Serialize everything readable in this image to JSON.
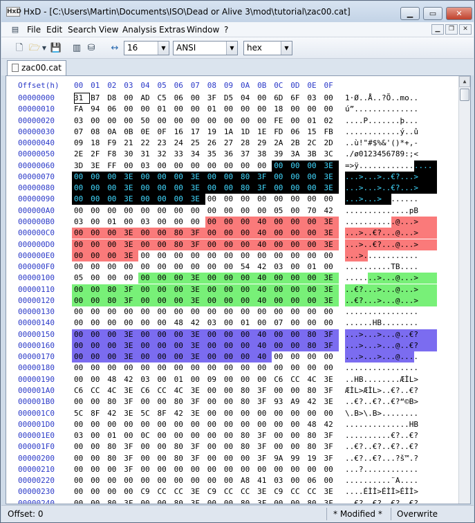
{
  "window": {
    "title": "HxD - [C:\\Users\\Martin\\Documents\\ISO\\Dead or Alive 3\\mod\\tutorial\\zac00.cat]",
    "app_icon": "HxD"
  },
  "menu": [
    "File",
    "Edit",
    "Search",
    "View",
    "Analysis",
    "Extras",
    "Window",
    "?"
  ],
  "toolbar": {
    "bytes_per_row": "16",
    "charset": "ANSI",
    "offset_base": "hex"
  },
  "tab": {
    "label": "zac00.cat"
  },
  "header": {
    "offset_label": "Offset(h)",
    "columns": [
      "00",
      "01",
      "02",
      "03",
      "04",
      "05",
      "06",
      "07",
      "08",
      "09",
      "0A",
      "0B",
      "0C",
      "0D",
      "0E",
      "0F"
    ]
  },
  "colors": {
    "black": "#000000",
    "red": "#fa7a7a",
    "green": "#78f078",
    "blue": "#7b6cf0",
    "offset": "#2a39c8"
  },
  "rows": [
    {
      "offset": "00000000",
      "bytes": "31 B7 D8 00 AD C5 06 00 3F D5 04 00 6D 6F 03 00",
      "ascii": "1·Ø..Å..?Õ..mo.."
    },
    {
      "offset": "00000010",
      "bytes": "FA 94 06 00 00 01 00 00 01 00 00 00 18 00 00 00",
      "ascii": "ú”.............."
    },
    {
      "offset": "00000020",
      "bytes": "03 00 00 00 50 00 00 00 00 00 00 00 FE 00 01 02",
      "ascii": "....P.......þ..."
    },
    {
      "offset": "00000030",
      "bytes": "07 08 0A 0B 0E 0F 16 17 19 1A 1D 1E FD 06 15 FB",
      "ascii": "............ý..û"
    },
    {
      "offset": "00000040",
      "bytes": "09 18 F9 21 22 23 24 25 26 27 28 29 2A 2B 2C 2D",
      "ascii": "..ù!\"#$%&'()*+,-"
    },
    {
      "offset": "00000050",
      "bytes": "2E 2F F8 30 31 32 33 34 35 36 37 38 39 3A 3B 3C",
      "ascii": "./ø0123456789:;<"
    },
    {
      "offset": "00000060",
      "bytes": "3D 3E FF 00 03 00 00 00 00 00 00 00 00 00 00 3E",
      "ascii": "=>ÿ.............>"
    },
    {
      "offset": "00000070",
      "bytes": "00 00 00 3E 00 00 00 3E 00 00 80 3F 00 00 00 3E",
      "ascii": "...>...>..€?...>"
    },
    {
      "offset": "00000080",
      "bytes": "00 00 00 3E 00 00 00 3E 00 00 80 3F 00 00 00 3E",
      "ascii": "...>...>..€?...>"
    },
    {
      "offset": "00000090",
      "bytes": "00 00 00 3E 00 00 00 3E 00 00 00 00 00 00 00 00",
      "ascii": "...>...>........"
    },
    {
      "offset": "000000A0",
      "bytes": "00 00 00 00 00 00 00 00 00 00 00 00 05 00 70 42",
      "ascii": "..............pB"
    },
    {
      "offset": "000000B0",
      "bytes": "03 00 01 00 03 00 00 00 00 00 00 40 00 00 00 3E",
      "ascii": "...........@...>"
    },
    {
      "offset": "000000C0",
      "bytes": "00 00 00 3E 00 00 80 3F 00 00 00 40 00 00 00 3E",
      "ascii": "...>..€?...@...>"
    },
    {
      "offset": "000000D0",
      "bytes": "00 00 00 3E 00 00 80 3F 00 00 00 40 00 00 00 3E",
      "ascii": "...>..€?...@...>"
    },
    {
      "offset": "000000E0",
      "bytes": "00 00 00 3E 00 00 00 00 00 00 00 00 00 00 00 00",
      "ascii": "...>............"
    },
    {
      "offset": "000000F0",
      "bytes": "00 00 00 00 00 00 00 00 00 00 54 42 03 00 01 00",
      "ascii": "..........TB...."
    },
    {
      "offset": "00000100",
      "bytes": "05 00 00 00 00 00 00 3E 00 00 00 40 00 00 00 3E",
      "ascii": ".......>...@...>"
    },
    {
      "offset": "00000110",
      "bytes": "00 00 80 3F 00 00 00 3E 00 00 00 40 00 00 00 3E",
      "ascii": "..€?...>...@...>"
    },
    {
      "offset": "00000120",
      "bytes": "00 00 80 3F 00 00 00 3E 00 00 00 40 00 00 00 3E",
      "ascii": "..€?...>...@...>"
    },
    {
      "offset": "00000130",
      "bytes": "00 00 00 00 00 00 00 00 00 00 00 00 00 00 00 00",
      "ascii": "................"
    },
    {
      "offset": "00000140",
      "bytes": "00 00 00 00 00 00 48 42 03 00 01 00 07 00 00 00",
      "ascii": "......HB........"
    },
    {
      "offset": "00000150",
      "bytes": "00 00 00 3E 00 00 00 3E 00 00 00 40 00 00 80 3F",
      "ascii": "...>...>...@..€?"
    },
    {
      "offset": "00000160",
      "bytes": "00 00 00 3E 00 00 00 3E 00 00 00 40 00 00 80 3F",
      "ascii": "...>...>...@..€?"
    },
    {
      "offset": "00000170",
      "bytes": "00 00 00 3E 00 00 00 3E 00 00 00 40 00 00 00 00",
      "ascii": "...>...>...@...."
    },
    {
      "offset": "00000180",
      "bytes": "00 00 00 00 00 00 00 00 00 00 00 00 00 00 00 00",
      "ascii": "................"
    },
    {
      "offset": "00000190",
      "bytes": "00 00 48 42 03 00 01 00 09 00 00 00 C6 CC 4C 3E",
      "ascii": "..HB........ÆÌL>"
    },
    {
      "offset": "000001A0",
      "bytes": "C6 CC 4C 3E C6 CC 4C 3E 00 00 80 3F 00 00 80 3F",
      "ascii": "ÆÌL>ÆÌL>..€?..€?"
    },
    {
      "offset": "000001B0",
      "bytes": "00 00 80 3F 00 00 80 3F 00 00 80 3F 93 A9 42 3E",
      "ascii": "..€?..€?..€?“©B>"
    },
    {
      "offset": "000001C0",
      "bytes": "5C 8F 42 3E 5C 8F 42 3E 00 00 00 00 00 00 00 00",
      "ascii": "\\.B>\\.B>........"
    },
    {
      "offset": "000001D0",
      "bytes": "00 00 00 00 00 00 00 00 00 00 00 00 00 00 48 42",
      "ascii": "..............HB"
    },
    {
      "offset": "000001E0",
      "bytes": "03 00 01 00 0C 00 00 00 00 00 80 3F 00 00 80 3F",
      "ascii": "..........€?..€?"
    },
    {
      "offset": "000001F0",
      "bytes": "00 00 80 3F 00 00 80 3F 00 00 80 3F 00 00 80 3F",
      "ascii": "..€?..€?..€?..€?"
    },
    {
      "offset": "00000200",
      "bytes": "00 00 80 3F 00 00 80 3F 00 00 00 3F 9A 99 19 3F",
      "ascii": "..€?..€?...?š™.?"
    },
    {
      "offset": "00000210",
      "bytes": "00 00 00 3F 00 00 00 00 00 00 00 00 00 00 00 00",
      "ascii": "...?............"
    },
    {
      "offset": "00000220",
      "bytes": "00 00 00 00 00 00 00 00 00 00 A8 41 03 00 06 00",
      "ascii": "..........¨A...."
    },
    {
      "offset": "00000230",
      "bytes": "00 00 00 00 C9 CC CC 3E C9 CC CC 3E C9 CC CC 3E",
      "ascii": "....ÉÌÌ>ÉÌÌ>ÉÌÌ>"
    },
    {
      "offset": "00000240",
      "bytes": "00 00 80 3F 00 00 80 3F 00 00 80 3F 00 00 80 3F",
      "ascii": "..€?..€?..€?..€?"
    }
  ],
  "status": {
    "offset": "Offset: 0",
    "modified": "* Modified *",
    "mode": "Overwrite"
  }
}
